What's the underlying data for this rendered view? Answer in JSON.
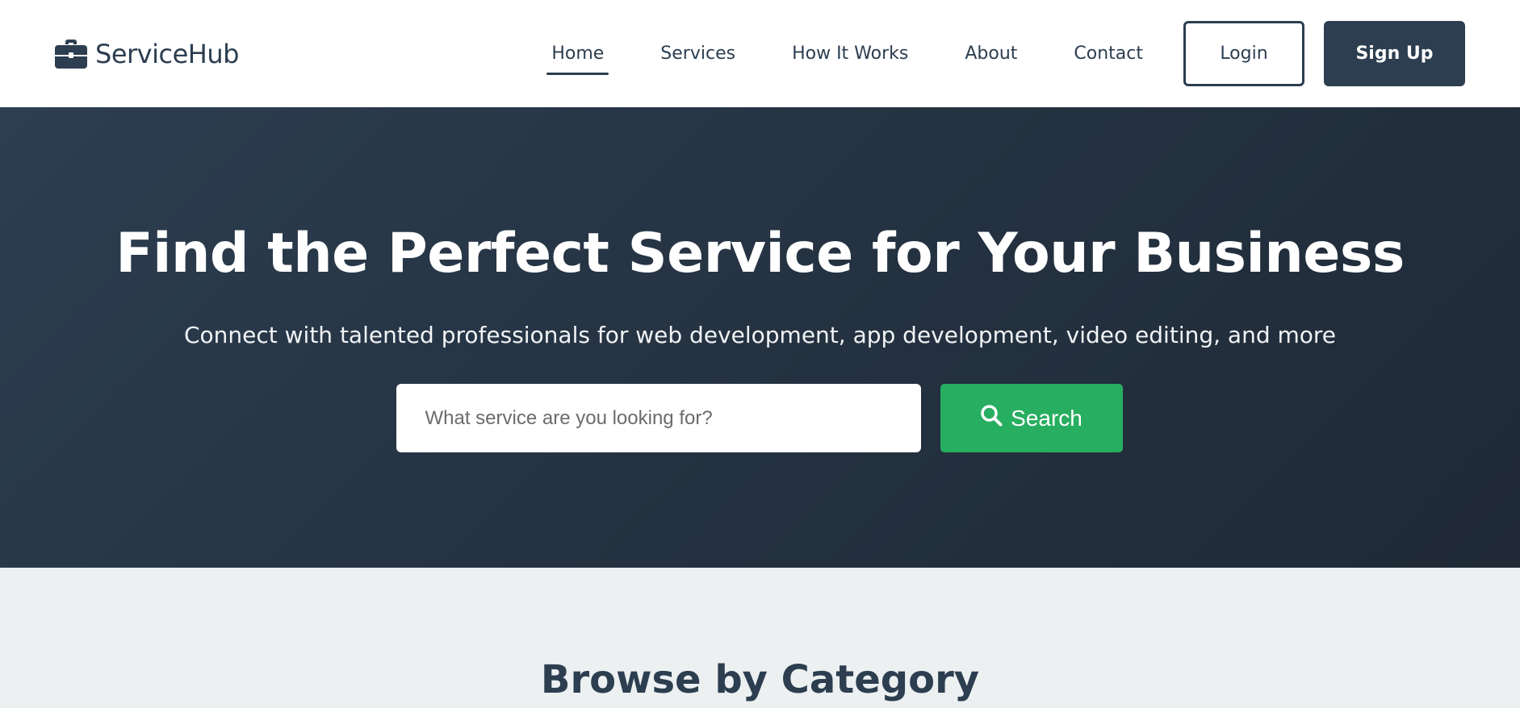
{
  "brand": {
    "name": "ServiceHub",
    "icon": "briefcase-icon"
  },
  "nav": {
    "links": [
      {
        "label": "Home",
        "active": true
      },
      {
        "label": "Services",
        "active": false
      },
      {
        "label": "How It Works",
        "active": false
      },
      {
        "label": "About",
        "active": false
      },
      {
        "label": "Contact",
        "active": false
      }
    ],
    "login_label": "Login",
    "signup_label": "Sign Up"
  },
  "hero": {
    "title": "Find the Perfect Service for Your Business",
    "subtitle": "Connect with talented professionals for web development, app development, video editing, and more",
    "search": {
      "placeholder": "What service are you looking for?",
      "value": "",
      "button_label": "Search",
      "button_icon": "search-icon"
    }
  },
  "categories": {
    "title": "Browse by Category"
  },
  "colors": {
    "primary": "#2c3e50",
    "accent": "#27ae60",
    "background": "#ecf0f1",
    "white": "#ffffff"
  }
}
